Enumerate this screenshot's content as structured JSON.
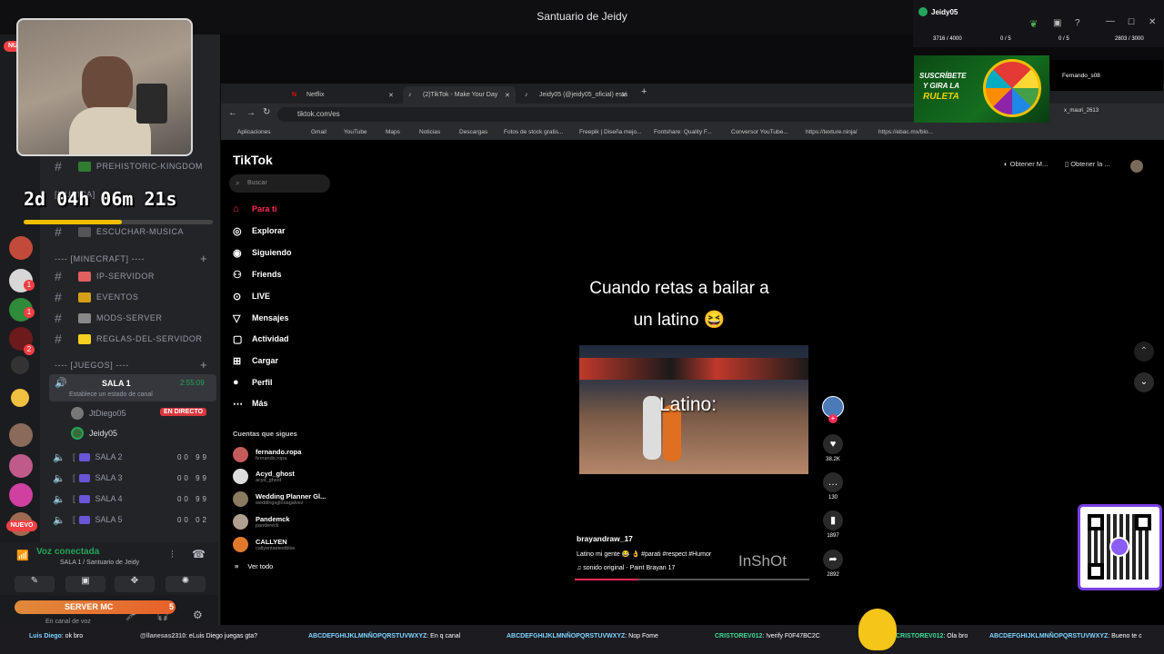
{
  "app_title": "Santuario de Jeidy",
  "timer": "2d 04h 06m 21s",
  "sidebar": {
    "ch_prehistoric": "PREHISTORIC-KINGDOM",
    "cat_musica": "[MUSICA]",
    "ch_musica": "ESCUCHAR-MUSICA",
    "cat_minecraft": "---- [MINECRAFT] ----",
    "mc_channels": [
      "IP-SERVIDOR",
      "EVENTOS",
      "MODS-SERVER",
      "REGLAS-DEL-SERVIDOR"
    ],
    "cat_juegos": "---- [JUEGOS] ----",
    "sala1": "SALA 1",
    "sala1_time": "2:55:09",
    "sala1_status": "Establece un estado de canal",
    "user1": "JtDiego05",
    "live_badge": "EN DIRECTO",
    "user2": "Jeidy05",
    "salas": [
      {
        "name": "SALA 2",
        "count": "00 99"
      },
      {
        "name": "SALA 3",
        "count": "00 99"
      },
      {
        "name": "SALA 4",
        "count": "00 99"
      },
      {
        "name": "SALA 5",
        "count": "00 02"
      }
    ],
    "voice_connected": "Voz conectada",
    "voice_channel": "SALA 1 / Santuario de Jeidy",
    "server_mc": "SERVER MC",
    "server_mc_num": "5",
    "status": "En canal de voz",
    "nuevo": "NUEVO",
    "nu": "NU"
  },
  "browser": {
    "tabs": [
      {
        "label": "Netflix"
      },
      {
        "label": "(2)TikTok - Make Your Day"
      },
      {
        "label": "Jeidy05 (@jeidy05_oficial) está"
      }
    ],
    "url": "tiktok.com/es",
    "bookmarks": [
      "Aplicaciones",
      "Gmail",
      "YouTube",
      "Maps",
      "Noticias",
      "Descargas",
      "Fotos de stock gratis...",
      "Freepik | Diseña mejo...",
      "Fontshare: Quality F...",
      "Conversor YouTube...",
      "https://texture.ninja/",
      "https://ebac.mx/blo..."
    ]
  },
  "tiktok": {
    "logo": "TikTok",
    "search_placeholder": "Buscar",
    "nav": [
      "Para ti",
      "Explorar",
      "Siguiendo",
      "Friends",
      "LIVE",
      "Mensajes",
      "Actividad",
      "Cargar",
      "Perfil",
      "Más"
    ],
    "following_header": "Cuentas que sigues",
    "following": [
      {
        "name": "fernando.ropa",
        "sub": "fernando.ropa"
      },
      {
        "name": "Acyd_ghost",
        "sub": "acyd_ghost"
      },
      {
        "name": "Wedding Planner Gl...",
        "sub": "weddingsgloriagalvez"
      },
      {
        "name": "Pandemck",
        "sub": "pandereck"
      },
      {
        "name": "CALLYEN",
        "sub": "callyentastestblse"
      }
    ],
    "see_all": "Ver todo",
    "caption_line1": "Cuando retas a bailar a",
    "caption_line2": "un latino 😆",
    "video_text": "Latino:",
    "author": "brayandraw_17",
    "desc": "Latino mi gente 😂 👌 #parati #respect #Humor",
    "sound": "sonido original - Paint Brayan 17",
    "watermark": "InShOt",
    "likes": "38.2K",
    "comments": "130",
    "saves": "1897",
    "shares": "2892",
    "top_btn1": "Obtener M...",
    "top_btn2": "Obtener la ..."
  },
  "overlay": {
    "user": "Jeidy05",
    "stats": [
      "3716 / 4000",
      "0 / 5",
      "0 / 5",
      "2803 / 3000"
    ],
    "promo_line1": "SUSCRÍBETE",
    "promo_line2": "Y GIRA LA",
    "promo_line3": "RULETA",
    "viewer1": "Fernando_s08",
    "viewer2": "x_mauri_2613"
  },
  "ticker": [
    {
      "user": "Luis Diego",
      "msg": ": ok bro"
    },
    {
      "user": "@llanesas2310",
      "msg": ": eLuis Diego juegas gta?"
    },
    {
      "user": "ABCDEFGHIJKLMNÑOPQRSTUVWXYZ",
      "msg": ": En q canal"
    },
    {
      "user": "ABCDEFGHIJKLMNÑOPQRSTUVWXYZ",
      "msg": ": Nop Fome"
    },
    {
      "user": "CRISTOREV012",
      "msg": ": !verify F0F47BC2C"
    },
    {
      "user": "CRISTOREV012",
      "msg": ": Ola bro"
    },
    {
      "user": "ABCDEFGHIJKLMNÑOPQRSTUVWXYZ",
      "msg": ": Bueno te c"
    }
  ]
}
